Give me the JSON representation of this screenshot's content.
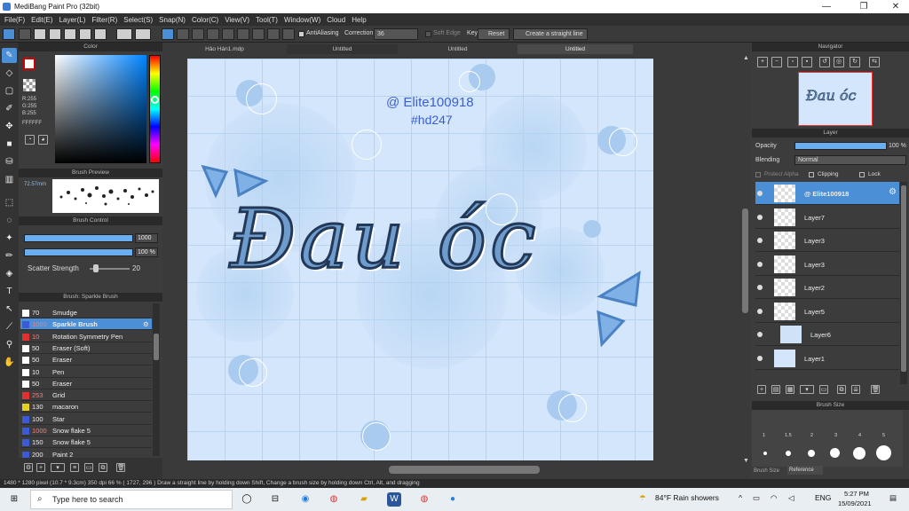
{
  "window": {
    "title": "MediBang Paint Pro (32bit)",
    "controls": [
      "—",
      "❐",
      "✕"
    ]
  },
  "menu": [
    "File(F)",
    "Edit(E)",
    "Layer(L)",
    "Filter(R)",
    "Select(S)",
    "Snap(N)",
    "Color(C)",
    "View(V)",
    "Tool(T)",
    "Window(W)",
    "Cloud",
    "Help"
  ],
  "toolbar": {
    "antialiasing_label": "AntiAliasing",
    "correction_label": "Correction",
    "correction_value": "36",
    "soft_edge_label": "Soft Edge",
    "key_label": "Key",
    "reset_label": "Reset",
    "straight_line_label": "Create a straight line"
  },
  "doc_tabs": [
    "Hảo Hán1.mdp",
    "Untitled",
    "Untitled",
    "Untitled"
  ],
  "color_panel": {
    "title": "Color",
    "r": "R:255",
    "g": "G:255",
    "b": "B:255",
    "hex": "FFFFFF",
    "foreground": "#ffffff"
  },
  "brush_preview": {
    "title": "Brush Preview",
    "size": "72.57mm"
  },
  "brush_control": {
    "title": "Brush Control",
    "size_value": "1000",
    "opacity_value": "100 %",
    "scatter_label": "Scatter Strength",
    "scatter_value": "20"
  },
  "brush_list": {
    "title": "Brush: Sparkle Brush",
    "items": [
      {
        "num": "70",
        "name": "Smudge",
        "color": "#ffffff"
      },
      {
        "num": "1000",
        "name": "Sparkle Brush",
        "color": "#3b5bd6",
        "selected": true
      },
      {
        "num": "10",
        "name": "Rotation Symmetry Pen",
        "color": "#e03030"
      },
      {
        "num": "50",
        "name": "Eraser (Soft)",
        "color": "#ffffff"
      },
      {
        "num": "50",
        "name": "Eraser",
        "color": "#ffffff"
      },
      {
        "num": "10",
        "name": "Pen",
        "color": "#ffffff"
      },
      {
        "num": "50",
        "name": "Eraser",
        "color": "#ffffff"
      },
      {
        "num": "253",
        "name": "Grid",
        "color": "#e03030"
      },
      {
        "num": "130",
        "name": "macaron",
        "color": "#e8d020"
      },
      {
        "num": "100",
        "name": "Star",
        "color": "#3b5bd6"
      },
      {
        "num": "1000",
        "name": "Snow flake 5",
        "color": "#3b5bd6"
      },
      {
        "num": "150",
        "name": "Snow flake 5",
        "color": "#3b5bd6"
      },
      {
        "num": "200",
        "name": "Paint 2",
        "color": "#3b5bd6"
      }
    ]
  },
  "canvas": {
    "watermark1": "@ Elite100918",
    "watermark2": "#hd247",
    "main_text": "Đau óc"
  },
  "navigator": {
    "title": "Navigator"
  },
  "layer_panel": {
    "title": "Layer",
    "opacity_label": "Opacity",
    "opacity_value": "100 %",
    "opacity_fraction": 1.0,
    "blending_label": "Blending",
    "blending_value": "Normal",
    "protect_alpha": "Protect Alpha",
    "clipping": "Clipping",
    "lock": "Lock",
    "layers": [
      {
        "name": "@ Elite100918",
        "selected": true
      },
      {
        "name": "Layer7"
      },
      {
        "name": "Layer3"
      },
      {
        "name": "Layer3"
      },
      {
        "name": "Layer2"
      },
      {
        "name": "Layer5"
      },
      {
        "name": "Layer6"
      },
      {
        "name": "Layer1"
      }
    ]
  },
  "brush_size_panel": {
    "title": "Brush Size",
    "sizes": [
      "1",
      "1.5",
      "2",
      "3",
      "4",
      "5"
    ],
    "tabs": [
      "Brush Size",
      "Reference"
    ]
  },
  "status": "1480 * 1280 pixel   (10.7 * 9.3cm)   350 dpi   66 %   ( 1727, 296 )   Draw a straight line by holding down Shift, Change a brush size by holding down Ctrl, Alt, and dragging",
  "taskbar": {
    "search_placeholder": "Type here to search",
    "weather": "84°F  Rain showers",
    "lang": "ENG",
    "time": "5:27 PM",
    "date": "15/09/2021"
  }
}
